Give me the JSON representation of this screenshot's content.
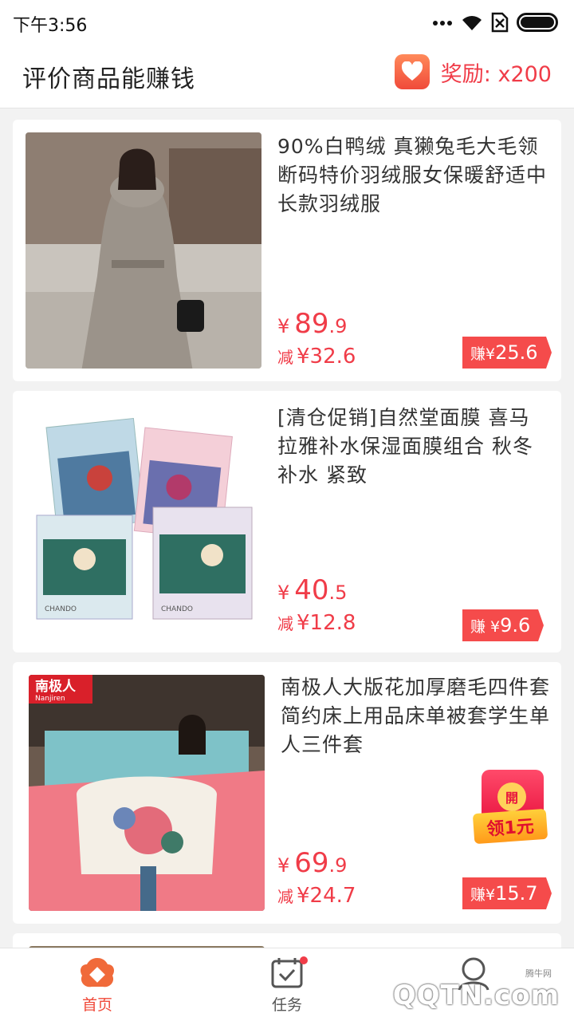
{
  "status_bar": {
    "time": "下午3:56"
  },
  "header": {
    "title": "评价商品能赚钱",
    "reward_label": "奖励: x200"
  },
  "products": [
    {
      "title": "90%白鸭绒  真獭兔毛大毛领断码特价羽绒服女保暖舒适中长款羽绒服",
      "price_currency": "¥",
      "price_int": "89",
      "price_dec": ".9",
      "discount_label": "减",
      "discount_value": "¥32.6",
      "earn_label": "赚¥",
      "earn_value": "25.6"
    },
    {
      "title": "[清仓促销]自然堂面膜  喜马拉雅补水保湿面膜组合 秋冬补水 紧致",
      "price_currency": "¥",
      "price_int": "40",
      "price_dec": ".5",
      "discount_label": "减",
      "discount_value": "¥12.8",
      "earn_label": "赚 ¥",
      "earn_value": "9.6",
      "image_text_1": "CHANDO",
      "image_text_2": "CHANDO"
    },
    {
      "title": "南极人大版花加厚磨毛四件套简约床上用品床单被套学生单人三件套",
      "price_currency": "¥",
      "price_int": "69",
      "price_dec": ".9",
      "discount_label": "减",
      "discount_value": "¥24.7",
      "earn_label": "赚¥",
      "earn_value": "15.7",
      "brand_cn": "南极人",
      "brand_en": "Nanjiren"
    }
  ],
  "red_packet": {
    "top": "開",
    "text": "领1元"
  },
  "tabs": [
    {
      "label": "首页"
    },
    {
      "label": "任务"
    }
  ],
  "watermark": {
    "small": "腾牛网",
    "main": "QQTN.com"
  }
}
